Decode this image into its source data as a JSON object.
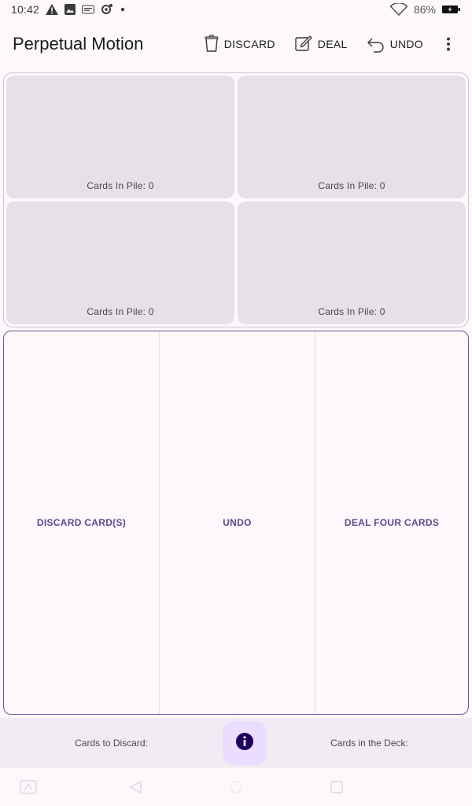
{
  "status_bar": {
    "time": "10:42",
    "battery_percent": "86%",
    "notification_icons": [
      "warning-icon",
      "image-icon",
      "photos-icon",
      "gear-bug-icon",
      "dot-icon"
    ],
    "right_icons": [
      "wifi-icon",
      "battery-icon"
    ]
  },
  "app_bar": {
    "title": "Perpetual Motion",
    "actions": {
      "discard_label": "DISCARD",
      "deal_label": "DEAL",
      "undo_label": "UNDO"
    },
    "overflow_icon": "more-vert-icon"
  },
  "piles": [
    {
      "count_label": "Cards In Pile: 0"
    },
    {
      "count_label": "Cards In Pile: 0"
    },
    {
      "count_label": "Cards In Pile: 0"
    },
    {
      "count_label": "Cards In Pile: 0"
    }
  ],
  "panel_buttons": {
    "discard": "DISCARD CARD(S)",
    "undo": "UNDO",
    "deal": "DEAL FOUR CARDS"
  },
  "info_bar": {
    "cards_to_discard_label": "Cards to Discard:",
    "cards_in_deck_label": "Cards in the Deck:",
    "info_icon": "info-icon"
  },
  "nav_bar": {
    "icons": [
      "accessibility-icon",
      "back-icon",
      "home-icon",
      "recents-icon"
    ]
  },
  "colors": {
    "background": "#fdf8fc",
    "pile_fill": "#e6e0e9",
    "panel_border": "#6e5a9b",
    "accent_text": "#5a4b8c",
    "info_button": "#eaddff",
    "info_bar": "#f1ecf4"
  }
}
